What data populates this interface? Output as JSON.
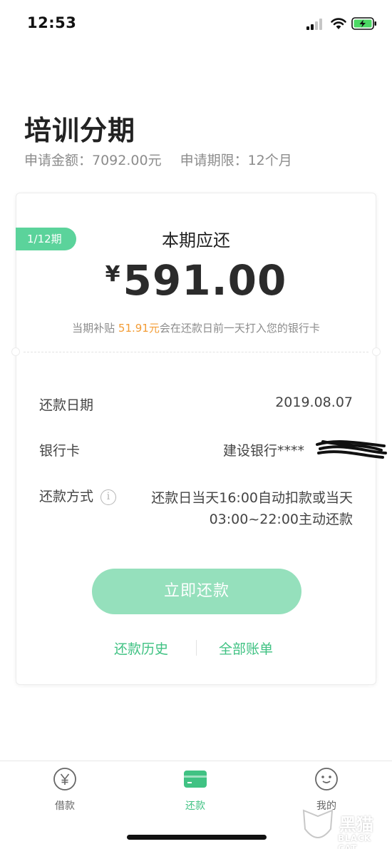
{
  "status_bar": {
    "time": "12:53"
  },
  "header": {
    "title": "培训分期",
    "apply_amount": "申请金额：7092.00元",
    "apply_term": "申请期限：12个月"
  },
  "card": {
    "period_badge": "1/12期",
    "due_label": "本期应还",
    "currency": "¥",
    "amount": "591.00",
    "subsidy_prefix": "当期补贴 ",
    "subsidy_amount": "51.91元",
    "subsidy_suffix": "会在还款日前一天打入您的银行卡",
    "rows": {
      "date_label": "还款日期",
      "date_value": "2019.08.07",
      "bank_label": "银行卡",
      "bank_value": "建设银行****",
      "method_label": "还款方式",
      "method_value": "还款日当天16:00自动扣款或当天03:00~22:00主动还款"
    },
    "repay_button": "立即还款",
    "history_link": "还款历史",
    "bills_link": "全部账单"
  },
  "tabbar": {
    "items": [
      {
        "label": "借款",
        "icon": "yen-circle-icon"
      },
      {
        "label": "还款",
        "icon": "card-icon",
        "active": true
      },
      {
        "label": "我的",
        "icon": "face-icon"
      }
    ]
  },
  "watermark": {
    "text": "黑猫",
    "sub": "BLACK CAT"
  },
  "colors": {
    "accent": "#40c283",
    "badge": "#5bd39b",
    "button": "#95e0bc",
    "highlight": "#f39c35"
  }
}
